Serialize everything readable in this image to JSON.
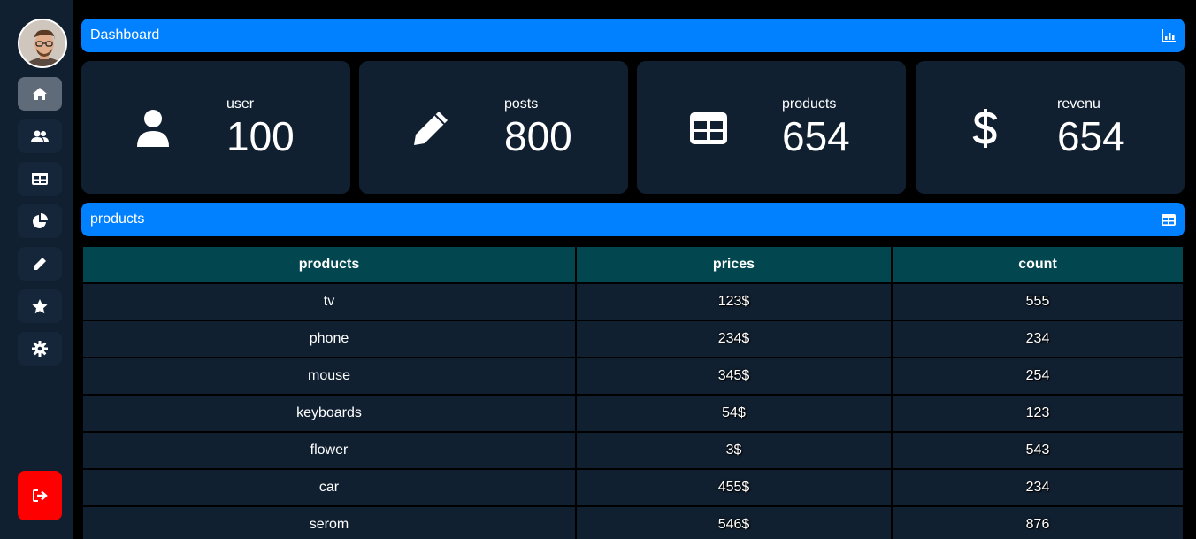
{
  "sidebar": {
    "avatar_icon": "user-avatar",
    "items": [
      {
        "icon": "home-icon",
        "active": true
      },
      {
        "icon": "users-icon",
        "active": false
      },
      {
        "icon": "table-icon",
        "active": false
      },
      {
        "icon": "pie-chart-icon",
        "active": false
      },
      {
        "icon": "pencil-icon",
        "active": false
      },
      {
        "icon": "star-icon",
        "active": false
      },
      {
        "icon": "gear-icon",
        "active": false
      }
    ],
    "logout_icon": "logout-icon"
  },
  "header": {
    "title": "Dashboard",
    "icon": "chart-bar-icon"
  },
  "stats": [
    {
      "label": "user",
      "value": "100",
      "icon": "user-icon"
    },
    {
      "label": "posts",
      "value": "800",
      "icon": "pencil-icon"
    },
    {
      "label": "products",
      "value": "654",
      "icon": "table-icon"
    },
    {
      "label": "revenu",
      "value": "654",
      "icon": "dollar-icon"
    }
  ],
  "products_section": {
    "title": "products",
    "icon": "table-icon"
  },
  "table": {
    "headers": [
      "products",
      "prices",
      "count"
    ],
    "rows": [
      [
        "tv",
        "123$",
        "555"
      ],
      [
        "phone",
        "234$",
        "234"
      ],
      [
        "mouse",
        "345$",
        "254"
      ],
      [
        "keyboards",
        "54$",
        "123"
      ],
      [
        "flower",
        "3$",
        "543"
      ],
      [
        "car",
        "455$",
        "234"
      ],
      [
        "serom",
        "546$",
        "876"
      ]
    ]
  },
  "colors": {
    "accent": "#0180ff",
    "panel": "#112031",
    "table_header": "#02474f",
    "logout": "#ff0000"
  }
}
